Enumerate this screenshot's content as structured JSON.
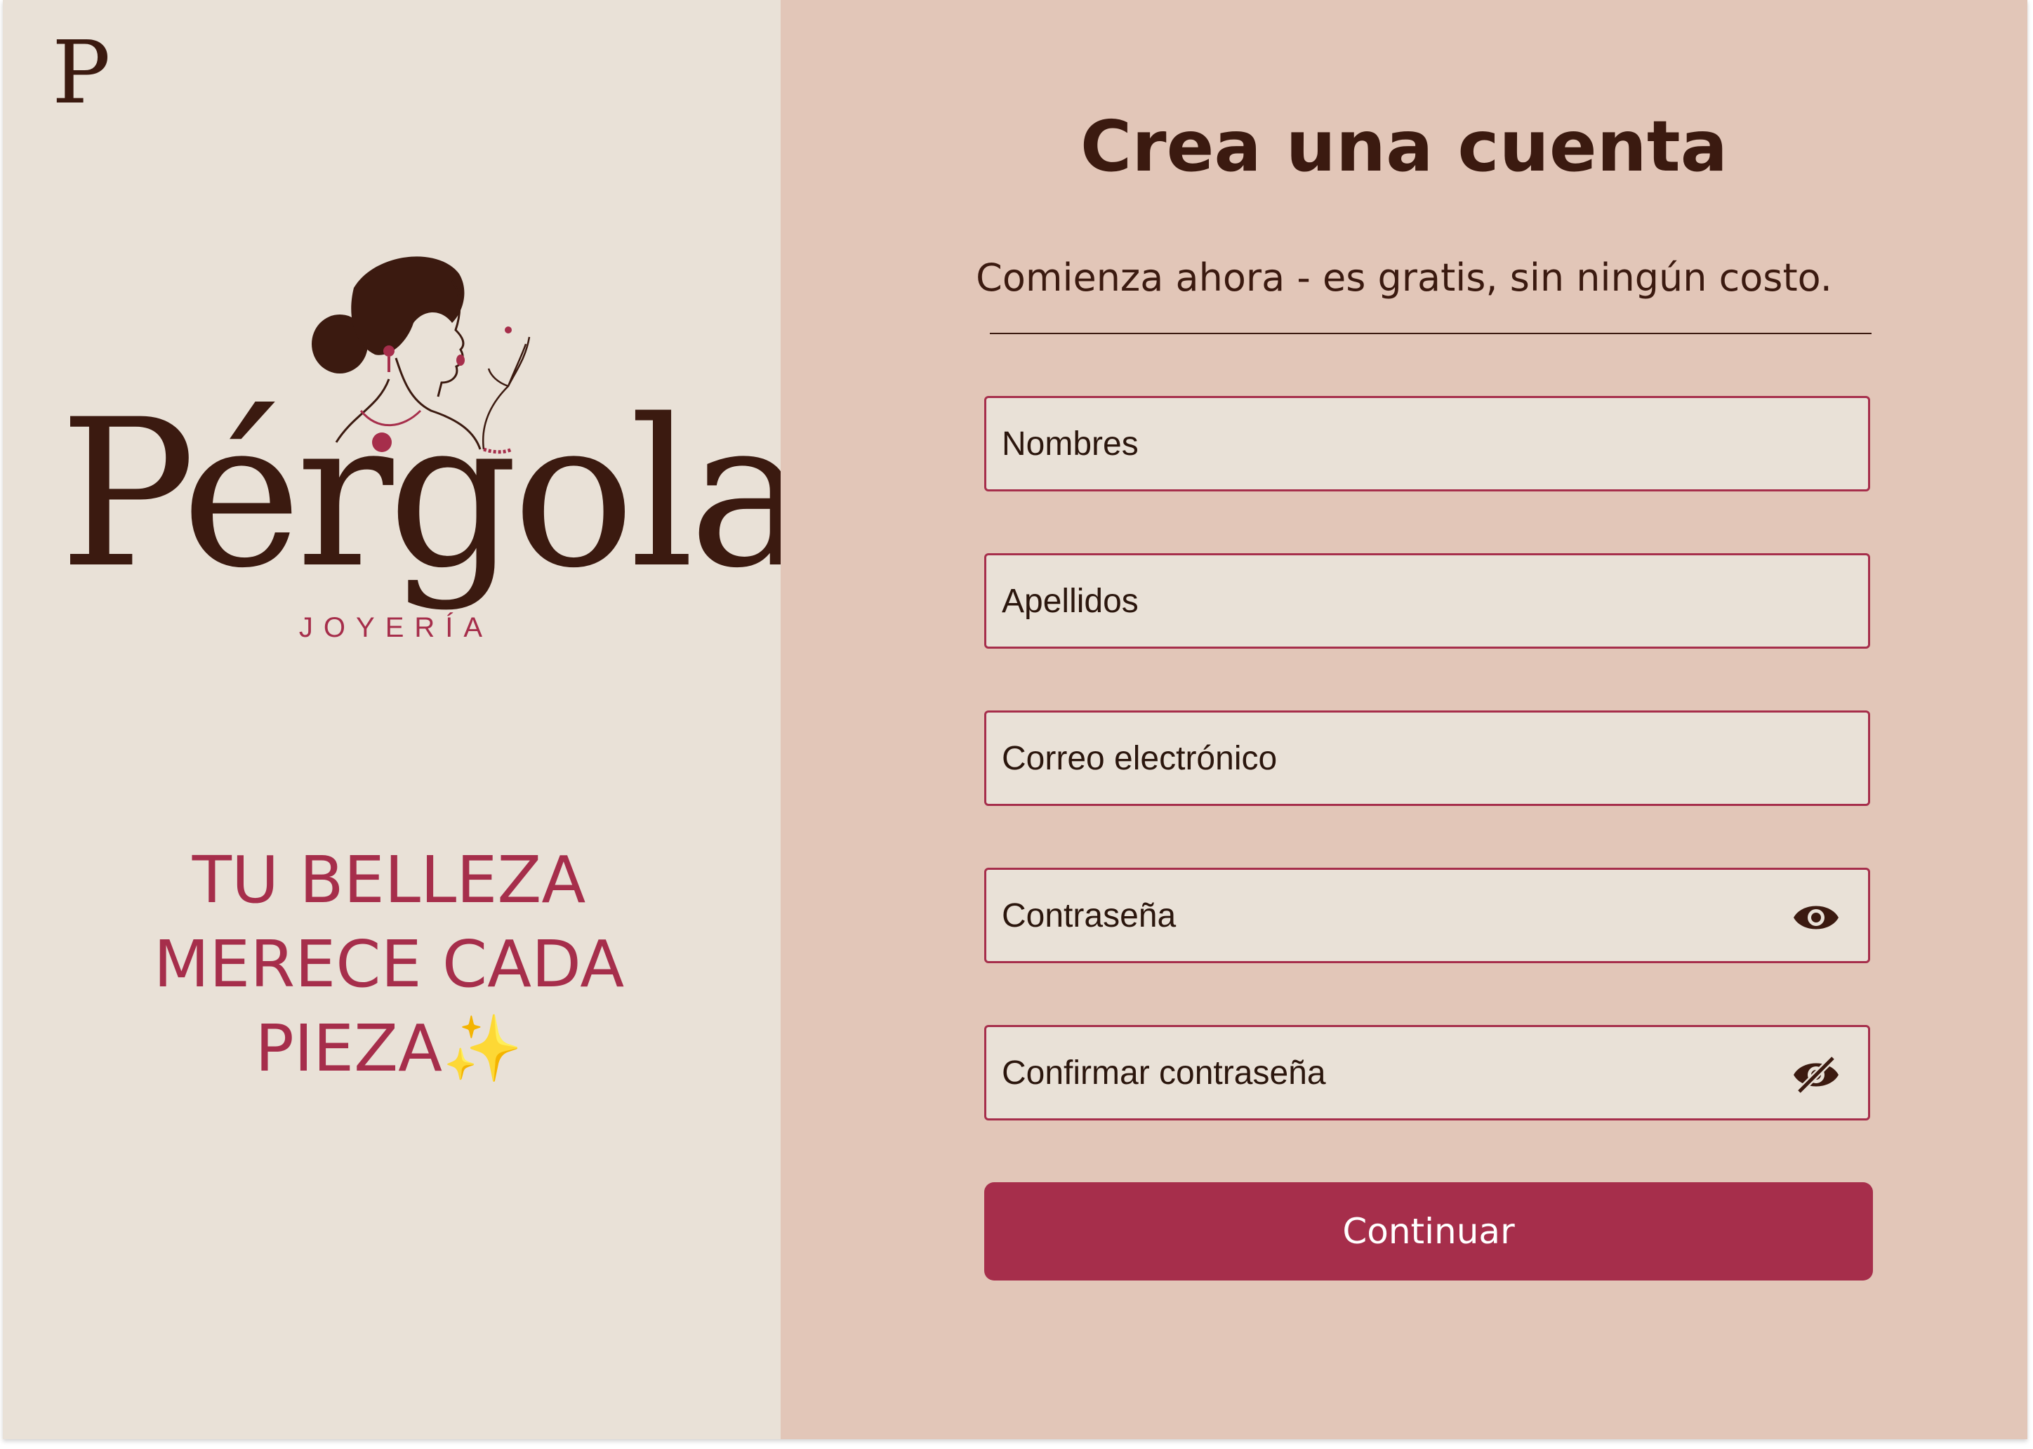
{
  "brand": {
    "mini_logo": "P",
    "name": "Pérgola",
    "subtitle": "JOYERÍA"
  },
  "tagline": {
    "line1": "TU BELLEZA",
    "line2": "MERECE CADA",
    "line3": "PIEZA",
    "sparkle": "✨"
  },
  "form": {
    "title": "Crea una cuenta",
    "subtitle": "Comienza ahora - es gratis, sin ningún costo.",
    "fields": {
      "first_name": {
        "placeholder": "Nombres",
        "value": ""
      },
      "last_name": {
        "placeholder": "Apellidos",
        "value": ""
      },
      "email": {
        "placeholder": "Correo electrónico",
        "value": ""
      },
      "password": {
        "placeholder": "Contraseña",
        "value": "",
        "icon": "eye-icon"
      },
      "confirm_password": {
        "placeholder": "Confirmar contraseña",
        "value": "",
        "icon": "eye-off-icon"
      }
    },
    "submit_label": "Continuar"
  },
  "colors": {
    "left_bg": "#e9e1d7",
    "right_bg": "#e2c6b8",
    "brand_dark": "#3b1a10",
    "accent": "#a62e4b"
  }
}
